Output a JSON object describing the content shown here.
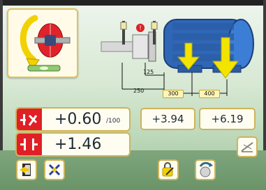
{
  "diagram": {
    "dims": {
      "d125": "125",
      "d250": "250",
      "d300": "300",
      "d400": "400"
    }
  },
  "readings": {
    "vertical_angle": "+0.60",
    "vertical_unit": "/100",
    "vertical_offset": "+1.46",
    "foot_front": "+3.94",
    "foot_back": "+6.19"
  }
}
